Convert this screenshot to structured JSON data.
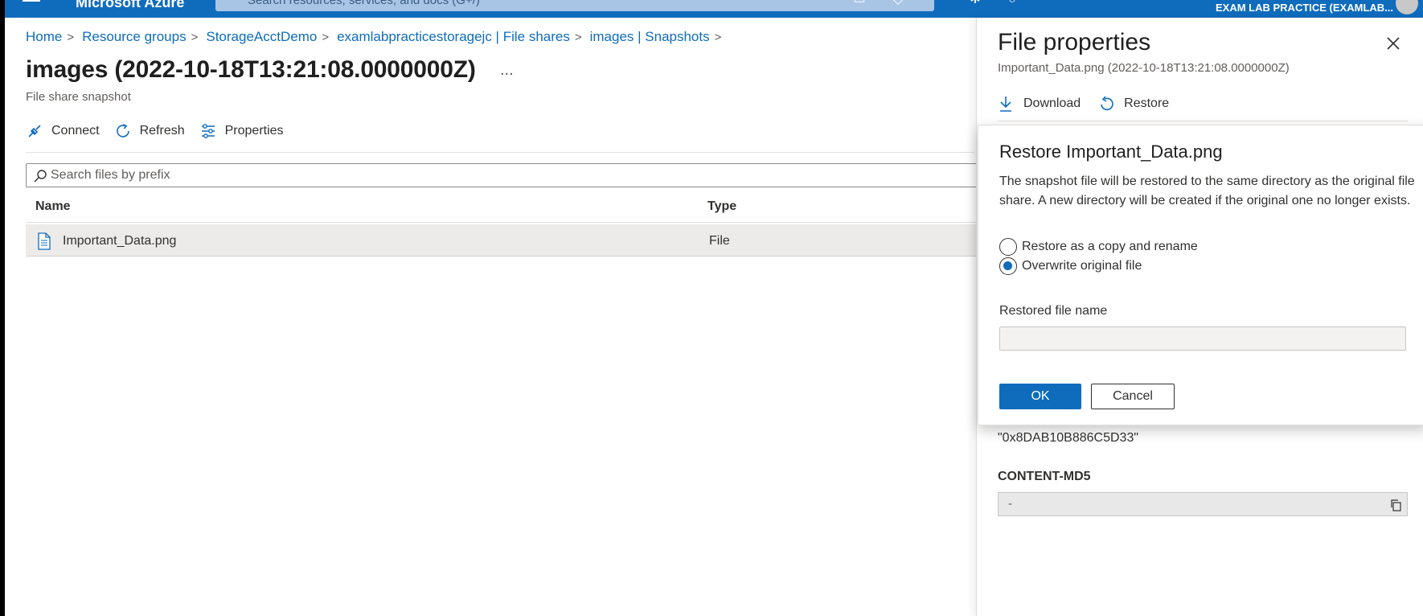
{
  "topbar": {
    "brand": "Microsoft Azure",
    "search_placeholder": "Search resources, services, and docs (G+/)",
    "account": "EXAM LAB PRACTICE (EXAMLAB...",
    "colors": {
      "bar": "#0f6cbd"
    }
  },
  "breadcrumb": [
    {
      "label": "Home"
    },
    {
      "label": "Resource groups"
    },
    {
      "label": "StorageAcctDemo"
    },
    {
      "label": "examlabpracticestoragejc | File shares"
    },
    {
      "label": "images | Snapshots"
    }
  ],
  "page": {
    "title": "images (2022-10-18T13:21:08.0000000Z)",
    "more": "...",
    "subtitle": "File share snapshot"
  },
  "toolbar": {
    "connect": "Connect",
    "refresh": "Refresh",
    "properties": "Properties"
  },
  "filter": {
    "placeholder": "Search files by prefix"
  },
  "table": {
    "columns": [
      "Name",
      "Type"
    ],
    "rows": [
      {
        "name": "Important_Data.png",
        "type": "File",
        "icon": "document-icon"
      }
    ]
  },
  "panel": {
    "title": "File properties",
    "subtitle": "Important_Data.png (2022-10-18T13:21:08.0000000Z)",
    "download": "Download",
    "restore": "Restore",
    "etag_value": "\"0x8DAB10B886C5D33\"",
    "md5_label": "CONTENT-MD5",
    "md5_value": "-"
  },
  "dialog": {
    "title": "Restore Important_Data.png",
    "body": "The snapshot file will be restored to the same directory as the original file share. A new directory will be created if the original one no longer exists.",
    "option_copy": "Restore as a copy and rename",
    "option_overwrite": "Overwrite original file",
    "selected_option": "overwrite",
    "filename_label": "Restored file name",
    "filename_value": "",
    "ok": "OK",
    "cancel": "Cancel"
  }
}
